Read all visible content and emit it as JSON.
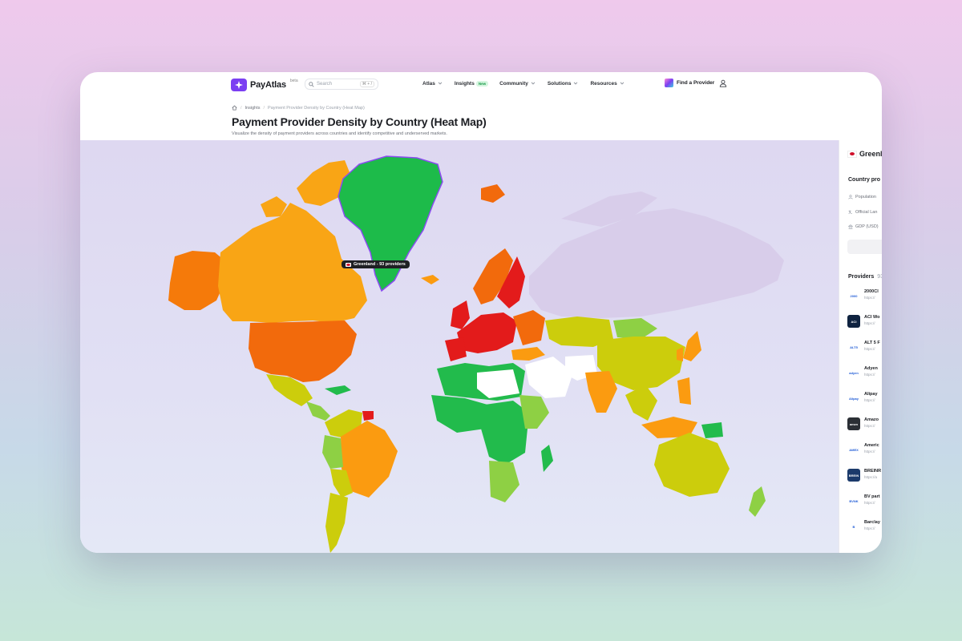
{
  "nav": {
    "logo_text": "PayAtlas",
    "beta_label": "beta",
    "search_placeholder": "Search",
    "search_shortcut": "⌘ + /",
    "menu": [
      {
        "label": "Atlas"
      },
      {
        "label": "Insights",
        "badge": "New"
      },
      {
        "label": "Community"
      },
      {
        "label": "Solutions"
      },
      {
        "label": "Resources"
      }
    ],
    "find_provider": "Find a Provider"
  },
  "breadcrumb": {
    "section": "Insights",
    "current": "Payment Provider Density by Country (Heat Map)"
  },
  "page": {
    "title": "Payment Provider Density by Country (Heat Map)",
    "subtitle": "Visualize the density of payment providers across countries and identify competitive and underserved markets."
  },
  "map": {
    "tooltip": "Greenland - 93 providers",
    "colors": {
      "background": "#e0dcf2",
      "no_data": "#d8cdea",
      "very_high": "#e31b1b",
      "high": "#f26a0c",
      "mid_high": "#fb9b10",
      "mid": "#cccd0c",
      "low": "#8ed044",
      "very_low": "#22bb4c",
      "none": "#ffffff"
    }
  },
  "panel": {
    "country": "Greenl",
    "country_section": "Country pro",
    "rows": [
      "Population",
      "Official Lan",
      "GDP (USD)"
    ],
    "providers_title": "Providers",
    "providers_count": "93",
    "providers": [
      {
        "name": "2000Cl",
        "url": "https://",
        "logo_color": "#ffffff",
        "logo_text": "2000"
      },
      {
        "name": "ACI Wo",
        "url": "https://",
        "logo_color": "#0f2340",
        "logo_text": "ACI"
      },
      {
        "name": "ALT 5 F",
        "url": "https://",
        "logo_color": "#ffffff",
        "logo_text": "ALT5"
      },
      {
        "name": "Adyen",
        "url": "https://",
        "logo_color": "#ffffff",
        "logo_text": "adyen"
      },
      {
        "name": "Alipay",
        "url": "https://",
        "logo_color": "#ffffff",
        "logo_text": "Alipay"
      },
      {
        "name": "Amazo",
        "url": "https://",
        "logo_color": "#2b2f35",
        "logo_text": "amzn"
      },
      {
        "name": "Americ",
        "url": "https://",
        "logo_color": "#ffffff",
        "logo_text": "AMEX"
      },
      {
        "name": "BREINR",
        "url": "https://a",
        "logo_color": "#1b3a6b",
        "logo_text": "BREIN"
      },
      {
        "name": "BV part",
        "url": "https://",
        "logo_color": "#ffffff",
        "logo_text": "BVNK"
      },
      {
        "name": "Barclay",
        "url": "https://",
        "logo_color": "#ffffff",
        "logo_text": "B"
      }
    ]
  }
}
